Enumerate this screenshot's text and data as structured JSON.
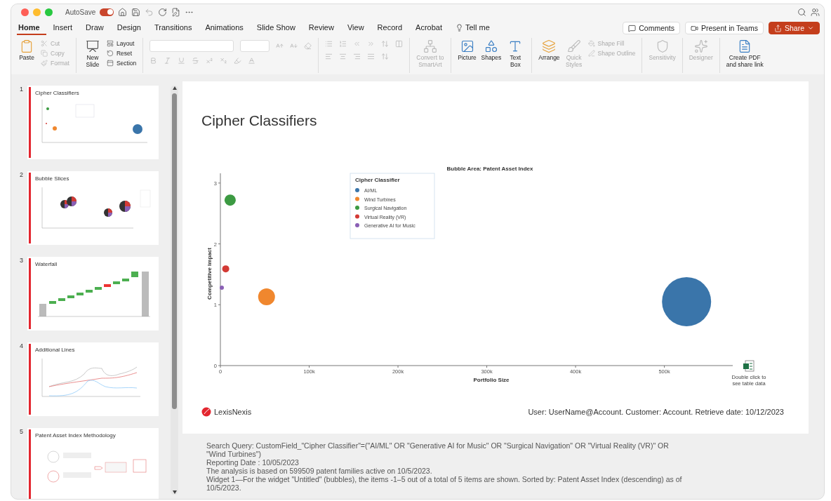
{
  "window": {
    "autosave": {
      "label": "AutoSave",
      "on": true
    }
  },
  "menu_tabs": [
    {
      "label": "Home",
      "selected": true
    },
    {
      "label": "Insert",
      "selected": false
    },
    {
      "label": "Draw",
      "selected": false
    },
    {
      "label": "Design",
      "selected": false
    },
    {
      "label": "Transitions",
      "selected": false
    },
    {
      "label": "Animations",
      "selected": false
    },
    {
      "label": "Slide Show",
      "selected": false
    },
    {
      "label": "Review",
      "selected": false
    },
    {
      "label": "View",
      "selected": false
    },
    {
      "label": "Record",
      "selected": false
    },
    {
      "label": "Acrobat",
      "selected": false
    },
    {
      "label": "Tell me",
      "selected": false
    }
  ],
  "header_buttons": [
    {
      "label": "Comments",
      "kind": "plain"
    },
    {
      "label": "Present in Teams",
      "kind": "plain"
    },
    {
      "label": "Share",
      "kind": "primary"
    }
  ],
  "ribbon": [
    {
      "kind": "buttons",
      "items": [
        {
          "kind": "large",
          "label": "Paste",
          "disabled": false
        },
        {
          "kind": "small",
          "label": "Cut",
          "disabled": true
        },
        {
          "kind": "small",
          "label": "Copy",
          "disabled": true
        },
        {
          "kind": "small",
          "label": "Format",
          "disabled": true
        }
      ]
    },
    {
      "kind": "buttons",
      "items": [
        {
          "kind": "large",
          "label": "New\nSlide",
          "disabled": false
        },
        {
          "kind": "small",
          "label": "Layout",
          "disabled": false
        },
        {
          "kind": "small",
          "label": "Reset",
          "disabled": false
        },
        {
          "kind": "small",
          "label": "Section",
          "disabled": false
        }
      ]
    },
    {
      "kind": "font",
      "disabled": true
    },
    {
      "kind": "paragraph",
      "disabled": true
    },
    {
      "kind": "buttons",
      "items": [
        {
          "kind": "large",
          "label": "Convert to\nSmartArt",
          "disabled": true
        }
      ]
    },
    {
      "kind": "buttons",
      "items": [
        {
          "kind": "large",
          "label": "Picture",
          "disabled": false
        },
        {
          "kind": "large",
          "label": "Shapes",
          "disabled": false
        },
        {
          "kind": "large",
          "label": "Text\nBox",
          "disabled": false
        }
      ]
    },
    {
      "kind": "buttons",
      "items": [
        {
          "kind": "large",
          "label": "Arrange",
          "disabled": false
        },
        {
          "kind": "large",
          "label": "Quick\nStyles",
          "disabled": true
        },
        {
          "kind": "small",
          "label": "Shape Fill",
          "disabled": true
        },
        {
          "kind": "small",
          "label": "Shape Outline",
          "disabled": true
        }
      ]
    },
    {
      "kind": "buttons",
      "items": [
        {
          "kind": "large",
          "label": "Sensitivity",
          "disabled": true
        }
      ]
    },
    {
      "kind": "buttons",
      "items": [
        {
          "kind": "large",
          "label": "Designer",
          "disabled": true
        }
      ]
    },
    {
      "kind": "buttons",
      "items": [
        {
          "kind": "large",
          "label": "Create PDF\nand share link",
          "disabled": false
        }
      ]
    }
  ],
  "thumbnails": [
    {
      "number": "1",
      "title": "Cipher Classifiers",
      "kind": "bubble"
    },
    {
      "number": "2",
      "title": "Bubble Slices",
      "kind": "pie"
    },
    {
      "number": "3",
      "title": "Waterfall",
      "kind": "waterfall"
    },
    {
      "number": "4",
      "title": "Additional Lines",
      "kind": "lines"
    },
    {
      "number": "5",
      "title": "Patent Asset Index Methodology",
      "kind": "diagram"
    }
  ],
  "slide": {
    "title": "Cipher Classifiers",
    "chart_data": {
      "type": "scatter",
      "title": "Bubble Area:  Patent Asset Index",
      "xlabel": "Portfolio Size",
      "ylabel": "Competitive Impact",
      "xlim": [
        0,
        577000
      ],
      "ylim": [
        0,
        3.16
      ],
      "xticks": [
        {
          "value": 0,
          "label": "0"
        },
        {
          "value": 100000,
          "label": "100k"
        },
        {
          "value": 200000,
          "label": "200k"
        },
        {
          "value": 300000,
          "label": "300k"
        },
        {
          "value": 400000,
          "label": "400k"
        },
        {
          "value": 500000,
          "label": "500k"
        }
      ],
      "yticks": [
        0,
        1,
        2,
        3
      ],
      "legend": {
        "title": "Cipher Classifier"
      },
      "series": [
        {
          "name": "AI/ML",
          "color": "#3a75aa",
          "x": [
            525000
          ],
          "values": [
            1.05
          ]
        },
        {
          "name": "Wind Turbines",
          "color": "#f0872e",
          "x": [
            52000
          ],
          "values": [
            1.13
          ]
        },
        {
          "name": "Surgical Navigation",
          "color": "#3c9a42",
          "x": [
            11000
          ],
          "values": [
            2.72
          ]
        },
        {
          "name": "Virtual Reality (VR)",
          "color": "#d33a35",
          "x": [
            6000
          ],
          "values": [
            1.59
          ]
        },
        {
          "name": "Generative AI for Music",
          "color": "#8a5fb5",
          "x": [
            1600
          ],
          "values": [
            1.28
          ]
        }
      ]
    },
    "table_hint": [
      "Double click to",
      "see table data"
    ],
    "logo": "LexisNexis",
    "footer": "User: UserName@Account. Customer: Account. Retrieve date: 10/12/2023"
  },
  "notes": [
    "Search Query: CustomField_\"Cipher Classifier\"=(\"AI/ML\" OR \"Generative AI for Music\" OR \"Surgical Navigation\" OR \"Virtual Reality (VR)\" OR \"Wind Turbines\")",
    "Reporting Date : 10/05/2023",
    "The analysis is based on 599509 patent families active on 10/5/2023.",
    "Widget 1—For the widget \"Untitled\" (bubbles), the items -1–5 out of a total of 5 items are shown. Sorted by: Patent Asset Index (descending) as of 10/5/2023."
  ]
}
